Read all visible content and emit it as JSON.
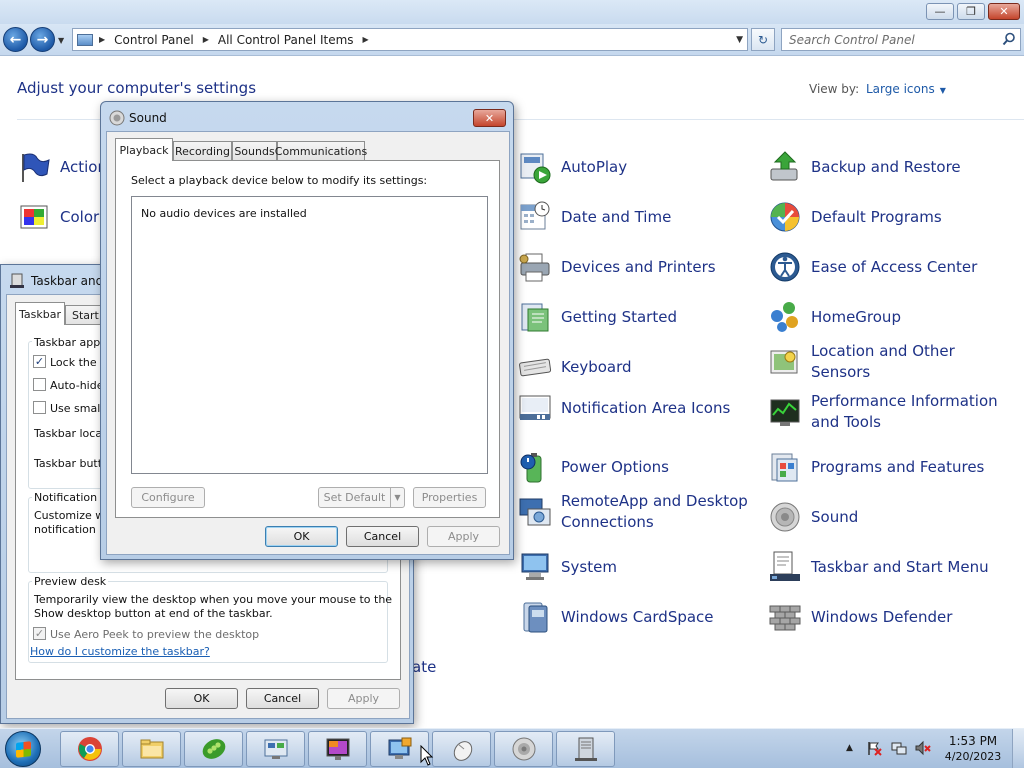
{
  "window": {
    "caption_buttons": {
      "minimize": "—",
      "maximize": "❐",
      "close": "✕"
    }
  },
  "nav": {
    "breadcrumb": [
      "Control Panel",
      "All Control Panel Items"
    ],
    "search_placeholder": "Search Control Panel",
    "back_icon": "back-arrow-icon",
    "forward_icon": "forward-arrow-icon"
  },
  "content": {
    "title": "Adjust your computer's settings",
    "view_by_label": "View by:",
    "view_by_value": "Large icons",
    "left_partial_items": [
      "Action",
      "Color"
    ],
    "partial_item_fragment": "ate",
    "items_col1": [
      {
        "label": "AutoPlay",
        "icon": "autoplay-icon"
      },
      {
        "label": "Date and Time",
        "icon": "calendar-clock-icon"
      },
      {
        "label": "Devices and Printers",
        "icon": "printer-icon"
      },
      {
        "label": "Getting Started",
        "icon": "getting-started-icon"
      },
      {
        "label": "Keyboard",
        "icon": "keyboard-icon"
      },
      {
        "label": "Notification Area Icons",
        "icon": "notification-area-icon"
      },
      {
        "label": "Power Options",
        "icon": "battery-icon"
      },
      {
        "label": "RemoteApp and Desktop Connections",
        "icon": "remote-desktop-icon"
      },
      {
        "label": "System",
        "icon": "computer-icon"
      },
      {
        "label": "Windows CardSpace",
        "icon": "cardspace-icon"
      }
    ],
    "items_col2": [
      {
        "label": "Backup and Restore",
        "icon": "backup-icon"
      },
      {
        "label": "Default Programs",
        "icon": "default-programs-icon"
      },
      {
        "label": "Ease of Access Center",
        "icon": "accessibility-icon"
      },
      {
        "label": "HomeGroup",
        "icon": "homegroup-icon"
      },
      {
        "label": "Location and Other Sensors",
        "icon": "location-sensor-icon"
      },
      {
        "label": "Performance Information and Tools",
        "icon": "performance-icon"
      },
      {
        "label": "Programs and Features",
        "icon": "programs-icon"
      },
      {
        "label": "Sound",
        "icon": "speaker-icon"
      },
      {
        "label": "Taskbar and Start Menu",
        "icon": "taskbar-icon"
      },
      {
        "label": "Windows Defender",
        "icon": "defender-wall-icon"
      }
    ]
  },
  "taskbar_dialog": {
    "title": "Taskbar and S",
    "tabs": [
      "Taskbar",
      "Start"
    ],
    "group_appearance": "Taskbar appe",
    "check_lock": "Lock the t",
    "check_autohide": "Auto-hide",
    "check_small": "Use small",
    "location_label": "Taskbar locat",
    "buttons_label": "Taskbar butt",
    "notification_heading": "Notification a",
    "notification_text_1": "Customize wh",
    "notification_text_2": "notification a",
    "preview_heading": "Preview desk",
    "preview_text_1": "Temporarily view the desktop when you move your mouse to the",
    "preview_text_2": "Show desktop button at end of the taskbar.",
    "aero_peek": "Use Aero Peek to preview the desktop",
    "help_link": "How do I customize the taskbar?",
    "ok": "OK",
    "cancel": "Cancel",
    "apply": "Apply"
  },
  "sound_dialog": {
    "title": "Sound",
    "tabs": [
      "Playback",
      "Recording",
      "Sounds",
      "Communications"
    ],
    "instruction": "Select a playback device below to modify its settings:",
    "empty_message": "No audio devices are installed",
    "configure": "Configure",
    "set_default": "Set Default",
    "properties": "Properties",
    "ok": "OK",
    "cancel": "Cancel",
    "apply": "Apply",
    "close": "✕"
  },
  "taskbar": {
    "pinned": [
      "chrome-icon",
      "file-explorer-icon",
      "peas-app-icon",
      "control-panel-icon",
      "monitor-icon",
      "display-settings-icon",
      "mouse-icon",
      "speaker-icon",
      "server-icon"
    ],
    "clock_time": "1:53 PM",
    "clock_date": "4/20/2023"
  }
}
